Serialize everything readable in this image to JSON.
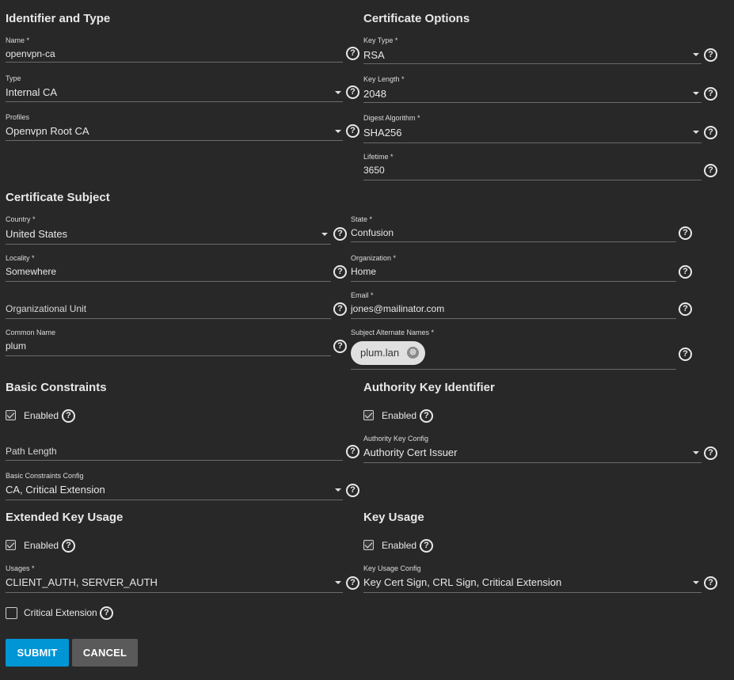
{
  "sections": {
    "identifier": "Identifier and Type",
    "cert_options": "Certificate Options",
    "cert_subject": "Certificate Subject",
    "basic_constraints": "Basic Constraints",
    "authority_key": "Authority Key Identifier",
    "extended_key_usage": "Extended Key Usage",
    "key_usage": "Key Usage"
  },
  "fields": {
    "name": {
      "label": "Name *",
      "value": "openvpn-ca"
    },
    "type": {
      "label": "Type",
      "value": "Internal CA"
    },
    "profiles": {
      "label": "Profiles",
      "value": "Openvpn Root CA"
    },
    "key_type": {
      "label": "Key Type *",
      "value": "RSA"
    },
    "key_length": {
      "label": "Key Length *",
      "value": "2048"
    },
    "digest": {
      "label": "Digest Algorithm *",
      "value": "SHA256"
    },
    "lifetime": {
      "label": "Lifetime *",
      "value": "3650"
    },
    "country": {
      "label": "Country *",
      "value": "United States"
    },
    "state": {
      "label": "State *",
      "value": "Confusion"
    },
    "locality": {
      "label": "Locality *",
      "value": "Somewhere"
    },
    "organization": {
      "label": "Organization *",
      "value": "Home"
    },
    "org_unit": {
      "placeholder": "Organizational Unit"
    },
    "email": {
      "label": "Email *",
      "value": "jones@mailinator.com"
    },
    "common_name": {
      "label": "Common Name",
      "value": "plum"
    },
    "san": {
      "label": "Subject Alternate Names *",
      "chip": "plum.lan",
      "chip_remove": "⊗"
    },
    "path_length": {
      "placeholder": "Path Length"
    },
    "basic_constraints_config": {
      "label": "Basic Constraints Config",
      "value": "CA, Critical Extension"
    },
    "authority_key_config": {
      "label": "Authority Key Config",
      "value": "Authority Cert Issuer"
    },
    "usages": {
      "label": "Usages *",
      "value": "CLIENT_AUTH, SERVER_AUTH"
    },
    "key_usage_config": {
      "label": "Key Usage Config",
      "value": "Key Cert Sign, CRL Sign, Critical Extension"
    }
  },
  "checkboxes": {
    "bc_enabled": {
      "label": "Enabled",
      "checked": true
    },
    "aki_enabled": {
      "label": "Enabled",
      "checked": true
    },
    "eku_enabled": {
      "label": "Enabled",
      "checked": true
    },
    "ku_enabled": {
      "label": "Enabled",
      "checked": true
    },
    "critical_ext": {
      "label": "Critical Extension",
      "checked": false
    }
  },
  "help_icon": "?",
  "buttons": {
    "submit": "SUBMIT",
    "cancel": "CANCEL"
  },
  "colors": {
    "background": "#282828",
    "primary": "#0095d5",
    "secondary_button": "#5a5a5a"
  }
}
